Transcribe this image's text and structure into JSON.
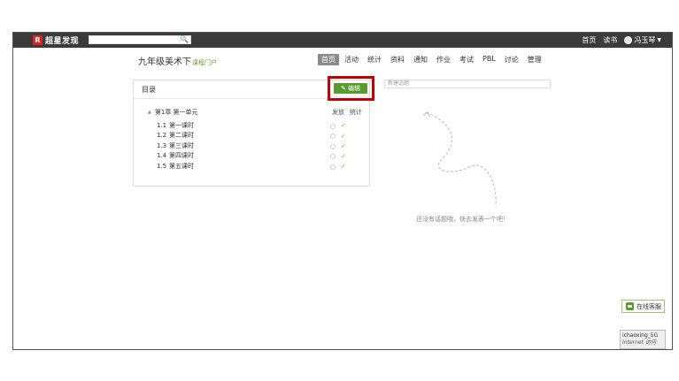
{
  "topbar": {
    "logo_mark": "R",
    "logo_text": "超星发现",
    "search_placeholder": "",
    "links": [
      "首页",
      "读书"
    ],
    "user_name": "冯玉琴"
  },
  "course": {
    "title": "九年级美术下",
    "portal_label": "课程门户"
  },
  "nav": {
    "items": [
      "首页",
      "活动",
      "统计",
      "资料",
      "通知",
      "作业",
      "考试",
      "PBL",
      "讨论",
      "管理"
    ],
    "active_index": 0
  },
  "directory": {
    "title": "目录",
    "edit_label": "编辑",
    "chapter": "第1章 第一单元",
    "col_release": "发放",
    "col_stats": "统计",
    "lessons": [
      {
        "num": "1.1",
        "title": "第一课时"
      },
      {
        "num": "1.2",
        "title": "第二课时"
      },
      {
        "num": "1.3",
        "title": "第三课时"
      },
      {
        "num": "1.4",
        "title": "第四课时"
      },
      {
        "num": "1.5",
        "title": "第五课时"
      }
    ]
  },
  "topics": {
    "input_placeholder": "新建话题",
    "empty_text": "还没有话题哦，快去发表一个吧！"
  },
  "widgets": {
    "online_service": "在线客服",
    "network_name": "ichaoxing_5G",
    "network_sub": "Internet 访问"
  },
  "colors": {
    "accent_green": "#5b9a2f",
    "highlight_red": "#c00000",
    "topbar": "#3b3b3b"
  }
}
